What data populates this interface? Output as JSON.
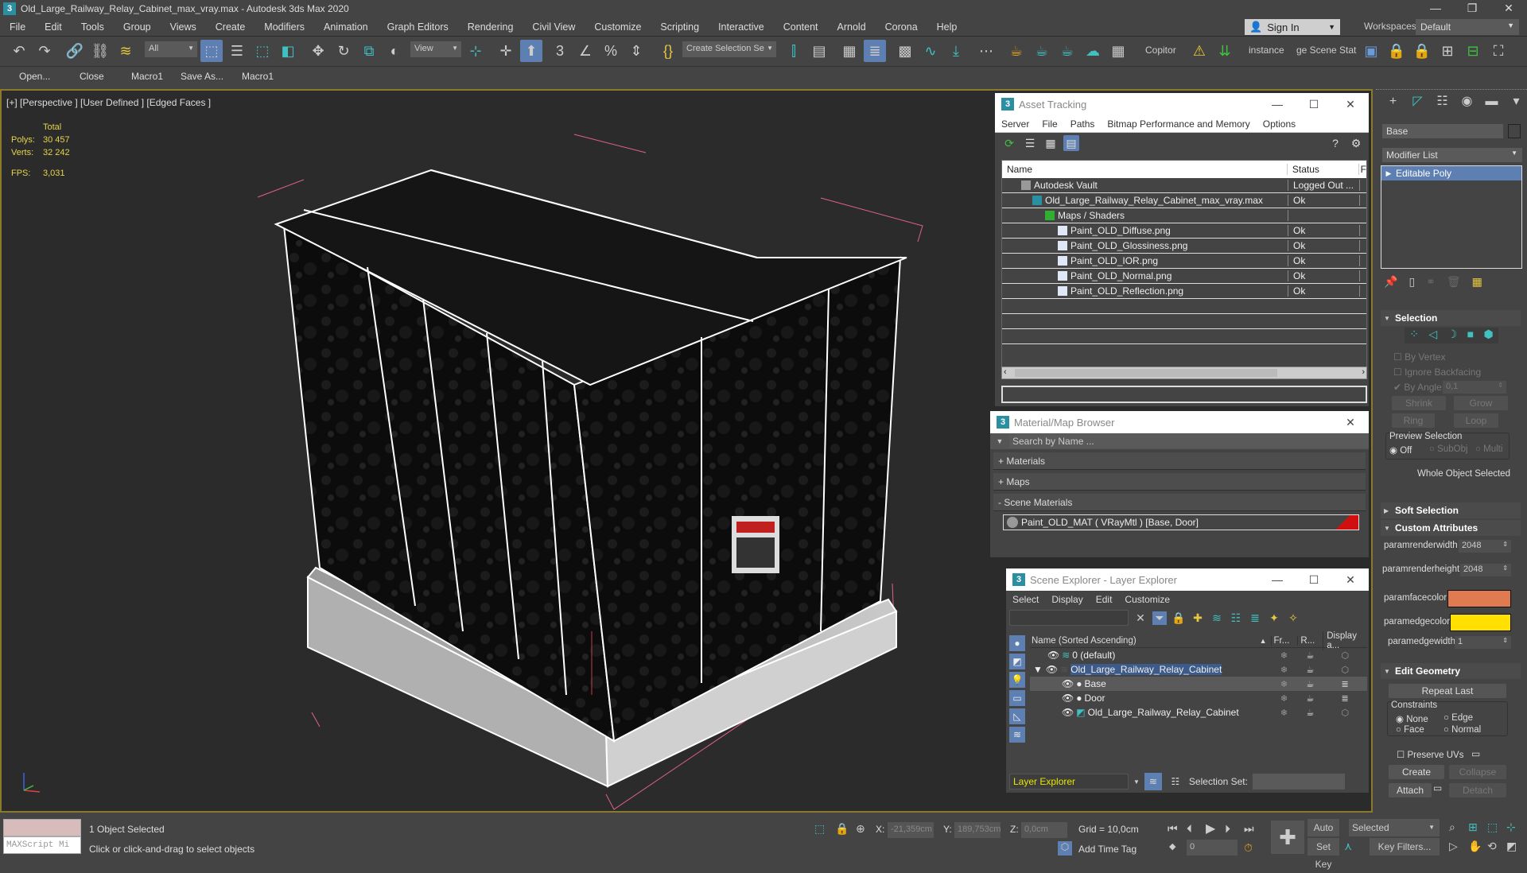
{
  "window": {
    "title": "Old_Large_Railway_Relay_Cabinet_max_vray.max - Autodesk 3ds Max 2020",
    "app_icon": "3",
    "controls": [
      "minimize-icon",
      "restore-icon",
      "close-icon"
    ]
  },
  "menu": [
    "File",
    "Edit",
    "Tools",
    "Group",
    "Views",
    "Create",
    "Modifiers",
    "Animation",
    "Graph Editors",
    "Rendering",
    "Civil View",
    "Customize",
    "Scripting",
    "Interactive",
    "Content",
    "Arnold",
    "Corona",
    "Help"
  ],
  "account": {
    "sign_in": "Sign In",
    "workspaces_label": "Workspaces:",
    "workspace": "Default"
  },
  "toolbar": {
    "selection_filter": "All",
    "ref_coord": "View",
    "named_selection": "Create Selection Se",
    "copitor": "Copitor",
    "instance": "instance",
    "scene_state": "ge Scene Stat"
  },
  "macrobar": [
    "Open...",
    "Close",
    "Macro1",
    "Save As...",
    "Macro1"
  ],
  "viewport": {
    "label": "[+] [Perspective ] [User Defined ] [Edged Faces ]",
    "stats": {
      "header": "Total",
      "polys_label": "Polys:",
      "polys": "30 457",
      "verts_label": "Verts:",
      "verts": "32 242",
      "fps_label": "FPS:",
      "fps": "3,031"
    }
  },
  "asset_tracking": {
    "title": "Asset Tracking",
    "menu": [
      "Server",
      "File",
      "Paths",
      "Bitmap Performance and Memory",
      "Options"
    ],
    "columns": [
      "Name",
      "Status",
      "F"
    ],
    "rows": [
      {
        "name": "Autodesk Vault",
        "status": "Logged Out ...",
        "indent": 1,
        "icon": "vault-icon"
      },
      {
        "name": "Old_Large_Railway_Relay_Cabinet_max_vray.max",
        "status": "Ok",
        "indent": 2,
        "icon": "max-file-icon"
      },
      {
        "name": "Maps / Shaders",
        "status": "",
        "indent": 3,
        "icon": "maps-icon"
      },
      {
        "name": "Paint_OLD_Diffuse.png",
        "status": "Ok",
        "indent": 4,
        "icon": "image-file-icon"
      },
      {
        "name": "Paint_OLD_Glossiness.png",
        "status": "Ok",
        "indent": 4,
        "icon": "image-file-icon"
      },
      {
        "name": "Paint_OLD_IOR.png",
        "status": "Ok",
        "indent": 4,
        "icon": "image-file-icon"
      },
      {
        "name": "Paint_OLD_Normal.png",
        "status": "Ok",
        "indent": 4,
        "icon": "image-file-icon"
      },
      {
        "name": "Paint_OLD_Reflection.png",
        "status": "Ok",
        "indent": 4,
        "icon": "image-file-icon"
      }
    ]
  },
  "material_browser": {
    "title": "Material/Map Browser",
    "search_placeholder": "Search by Name ...",
    "sections": [
      "+ Materials",
      "+ Maps",
      "- Scene Materials"
    ],
    "scene_material": "Paint_OLD_MAT  ( VRayMtl )  [Base, Door]"
  },
  "scene_explorer": {
    "title": "Scene Explorer - Layer Explorer",
    "menu": [
      "Select",
      "Display",
      "Edit",
      "Customize"
    ],
    "columns": {
      "name": "Name (Sorted Ascending)",
      "freeze": "Fr...",
      "render": "R...",
      "display": "Display a..."
    },
    "rows": [
      {
        "name": "0 (default)",
        "level": 1,
        "type": "layer"
      },
      {
        "name": "Old_Large_Railway_Relay_Cabinet",
        "level": 0,
        "type": "layer",
        "expanded": true,
        "selected": true
      },
      {
        "name": "Base",
        "level": 2,
        "type": "object",
        "highlighted": true
      },
      {
        "name": "Door",
        "level": 2,
        "type": "object"
      },
      {
        "name": "Old_Large_Railway_Relay_Cabinet",
        "level": 2,
        "type": "group"
      }
    ],
    "explorer_type": "Layer Explorer",
    "selection_set_label": "Selection Set:"
  },
  "command_panel": {
    "object_name": "Base",
    "modifier_list": "Modifier List",
    "stack": [
      "Editable Poly"
    ],
    "selection": {
      "title": "Selection",
      "by_vertex": "By Vertex",
      "ignore_backfacing": "Ignore Backfacing",
      "by_angle": "By Angle:",
      "angle": "0,1",
      "shrink": "Shrink",
      "grow": "Grow",
      "ring": "Ring",
      "loop": "Loop",
      "preview_label": "Preview Selection",
      "preview_options": [
        "Off",
        "SubObj",
        "Multi"
      ],
      "status": "Whole Object Selected"
    },
    "soft_selection": "Soft Selection",
    "custom_attributes": {
      "title": "Custom Attributes",
      "renderwidth_label": "paramrenderwidth",
      "renderwidth": "2048",
      "renderheight_label": "paramrenderheight",
      "renderheight": "2048",
      "facecolor_label": "paramfacecolor",
      "facecolor": "#e07a50",
      "edgecolor_label": "paramedgecolor",
      "edgecolor": "#ffe000",
      "edgewidth_label": "paramedgewidth",
      "edgewidth": "1"
    },
    "edit_geometry": {
      "title": "Edit Geometry",
      "repeat_last": "Repeat Last",
      "constraints_label": "Constraints",
      "constraints": [
        "None",
        "Edge",
        "Face",
        "Normal"
      ],
      "preserve_uvs": "Preserve UVs",
      "create": "Create",
      "collapse": "Collapse",
      "attach": "Attach",
      "detach": "Detach"
    }
  },
  "status": {
    "maxscript": "MAXScript Mi",
    "selected": "1 Object Selected",
    "prompt": "Click or click-and-drag to select objects",
    "x_label": "X:",
    "x": "-21,359cm",
    "y_label": "Y:",
    "y": "189,753cm",
    "z_label": "Z:",
    "z": "0,0cm",
    "grid": "Grid = 10,0cm",
    "add_time_tag": "Add Time Tag",
    "frame": "0",
    "auto_key": "Auto Key",
    "set_key": "Set Key",
    "key_mode": "Selected",
    "key_filters": "Key Filters..."
  }
}
